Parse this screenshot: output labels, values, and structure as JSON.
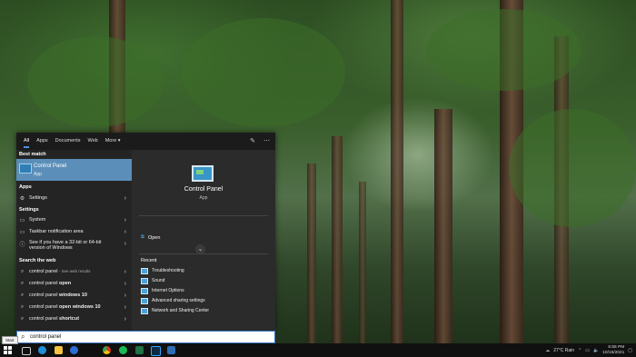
{
  "search_panel": {
    "tabs": [
      "All",
      "Apps",
      "Documents",
      "Web",
      "More ▾"
    ],
    "sections": {
      "best_match": "Best match",
      "apps": "Apps",
      "settings": "Settings",
      "search_web": "Search the web"
    },
    "best_match": {
      "title": "Control Panel",
      "subtitle": "App"
    },
    "apps": [
      {
        "label": "Settings"
      }
    ],
    "settings": [
      {
        "label": "System"
      },
      {
        "label": "Taskbar notification area"
      },
      {
        "label": "See if you have a 32-bit or 64-bit version of Windows"
      }
    ],
    "web": [
      {
        "prefix": "control panel",
        "suffix": " - See web results"
      },
      {
        "prefix": "control panel ",
        "bold": "open"
      },
      {
        "prefix": "control panel ",
        "bold": "windows 10"
      },
      {
        "prefix": "control panel ",
        "bold": "open windows 10"
      },
      {
        "prefix": "control panel ",
        "bold": "shortcut"
      }
    ],
    "preview": {
      "title": "Control Panel",
      "subtitle": "App",
      "open_label": "Open",
      "recent_header": "Recent",
      "recent": [
        "Troubleshooting",
        "Sound",
        "Internet Options",
        "Advanced sharing settings",
        "Network and Sharing Center"
      ]
    },
    "query": "control panel",
    "start_tooltip": "Start"
  },
  "tray": {
    "weather": "27°C  Rain",
    "time": "5:55 PM",
    "date": "10/15/2021"
  }
}
